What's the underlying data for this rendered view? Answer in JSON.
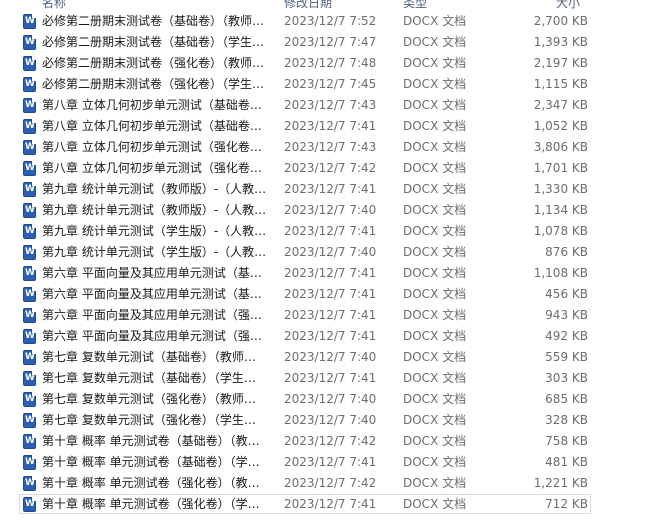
{
  "header": {
    "name": "名称",
    "date": "修改日期",
    "type": "类型",
    "size": "大小"
  },
  "files": [
    {
      "name": "必修第二册期末测试卷（基础卷）（教师…",
      "date": "2023/12/7 7:52",
      "type": "DOCX 文档",
      "size": "2,700 KB"
    },
    {
      "name": "必修第二册期末测试卷（基础卷）（学生…",
      "date": "2023/12/7 7:47",
      "type": "DOCX 文档",
      "size": "1,393 KB"
    },
    {
      "name": "必修第二册期末测试卷（强化卷）（教师…",
      "date": "2023/12/7 7:48",
      "type": "DOCX 文档",
      "size": "2,197 KB"
    },
    {
      "name": "必修第二册期末测试卷（强化卷）（学生…",
      "date": "2023/12/7 7:45",
      "type": "DOCX 文档",
      "size": "1,115 KB"
    },
    {
      "name": "第八章 立体几何初步单元测试（基础卷…",
      "date": "2023/12/7 7:43",
      "type": "DOCX 文档",
      "size": "2,347 KB"
    },
    {
      "name": "第八章 立体几何初步单元测试（基础卷…",
      "date": "2023/12/7 7:41",
      "type": "DOCX 文档",
      "size": "1,052 KB"
    },
    {
      "name": "第八章 立体几何初步单元测试（强化卷…",
      "date": "2023/12/7 7:43",
      "type": "DOCX 文档",
      "size": "3,806 KB"
    },
    {
      "name": "第八章 立体几何初步单元测试（强化卷…",
      "date": "2023/12/7 7:42",
      "type": "DOCX 文档",
      "size": "1,701 KB"
    },
    {
      "name": "第九章 统计单元测试（教师版）-（人教…",
      "date": "2023/12/7 7:41",
      "type": "DOCX 文档",
      "size": "1,330 KB"
    },
    {
      "name": "第九章 统计单元测试（教师版）-（人教…",
      "date": "2023/12/7 7:40",
      "type": "DOCX 文档",
      "size": "1,134 KB"
    },
    {
      "name": "第九章 统计单元测试（学生版）-（人教…",
      "date": "2023/12/7 7:41",
      "type": "DOCX 文档",
      "size": "1,078 KB"
    },
    {
      "name": "第九章 统计单元测试（学生版）-（人教…",
      "date": "2023/12/7 7:40",
      "type": "DOCX 文档",
      "size": "876 KB"
    },
    {
      "name": "第六章 平面向量及其应用单元测试（基…",
      "date": "2023/12/7 7:41",
      "type": "DOCX 文档",
      "size": "1,108 KB"
    },
    {
      "name": "第六章 平面向量及其应用单元测试（基…",
      "date": "2023/12/7 7:41",
      "type": "DOCX 文档",
      "size": "456 KB"
    },
    {
      "name": "第六章 平面向量及其应用单元测试（强…",
      "date": "2023/12/7 7:41",
      "type": "DOCX 文档",
      "size": "943 KB"
    },
    {
      "name": "第六章 平面向量及其应用单元测试（强…",
      "date": "2023/12/7 7:41",
      "type": "DOCX 文档",
      "size": "492 KB"
    },
    {
      "name": "第七章 复数单元测试（基础卷）（教师…",
      "date": "2023/12/7 7:40",
      "type": "DOCX 文档",
      "size": "559 KB"
    },
    {
      "name": "第七章 复数单元测试（基础卷）（学生…",
      "date": "2023/12/7 7:41",
      "type": "DOCX 文档",
      "size": "303 KB"
    },
    {
      "name": "第七章 复数单元测试（强化卷）（教师…",
      "date": "2023/12/7 7:40",
      "type": "DOCX 文档",
      "size": "685 KB"
    },
    {
      "name": "第七章 复数单元测试（强化卷）（学生…",
      "date": "2023/12/7 7:40",
      "type": "DOCX 文档",
      "size": "328 KB"
    },
    {
      "name": "第十章 概率 单元测试卷（基础卷）（教…",
      "date": "2023/12/7 7:42",
      "type": "DOCX 文档",
      "size": "758 KB"
    },
    {
      "name": "第十章 概率 单元测试卷（基础卷）（学…",
      "date": "2023/12/7 7:41",
      "type": "DOCX 文档",
      "size": "481 KB"
    },
    {
      "name": "第十章 概率 单元测试卷（强化卷）（教…",
      "date": "2023/12/7 7:42",
      "type": "DOCX 文档",
      "size": "1,221 KB"
    },
    {
      "name": "第十章 概率 单元测试卷（强化卷）（学…",
      "date": "2023/12/7 7:41",
      "type": "DOCX 文档",
      "size": "712 KB"
    }
  ],
  "icon": "word-document-icon"
}
